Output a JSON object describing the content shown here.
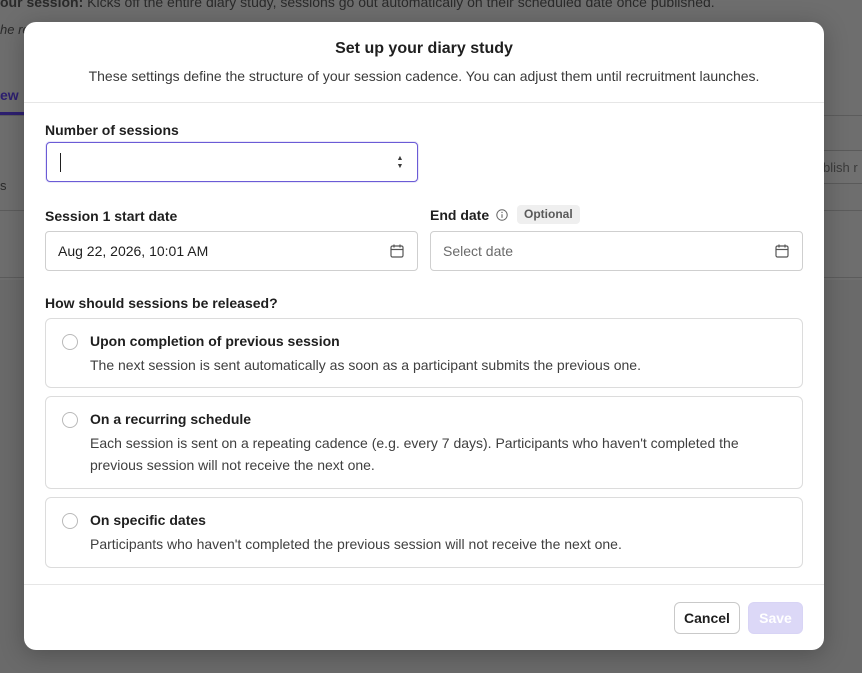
{
  "background": {
    "line1_bold": "our session:",
    "line1_rest": " Kicks off the entire diary study, sessions go out automatically on their scheduled date once published.",
    "line2": "he re",
    "tab_fragment": "ew",
    "left_fragment": "s",
    "button_fragment": "blish r"
  },
  "modal": {
    "title": "Set up your diary study",
    "subtitle": "These settings define the structure of your session cadence. You can adjust them until recruitment launches.",
    "sessions": {
      "label": "Number of sessions",
      "value": ""
    },
    "start_date": {
      "label": "Session 1 start date",
      "value": "Aug 22, 2026, 10:01 AM"
    },
    "end_date": {
      "label": "End date",
      "badge": "Optional",
      "placeholder": "Select date"
    },
    "release": {
      "question": "How should sessions be released?",
      "options": [
        {
          "title": "Upon completion of previous session",
          "description": "The next session is sent automatically as soon as a participant submits the previous one."
        },
        {
          "title": "On a recurring schedule",
          "description": "Each session is sent on a repeating cadence (e.g. every 7 days). Participants who haven't completed the previous session will not receive the next one."
        },
        {
          "title": "On specific dates",
          "description": "Participants who haven't completed the previous session will not receive the next one."
        }
      ]
    },
    "footer": {
      "cancel_label": "Cancel",
      "save_label": "Save"
    }
  },
  "colors": {
    "accent": "#6b5bd6",
    "save_disabled": "#dcd8f7",
    "overlay": "#6a6a6a"
  }
}
